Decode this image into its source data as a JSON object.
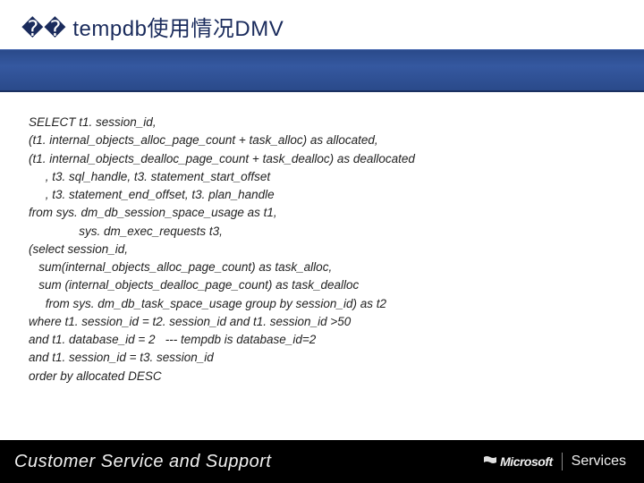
{
  "title": "�� tempdb使用情况DMV",
  "code_lines": [
    "SELECT t1. session_id,",
    "(t1. internal_objects_alloc_page_count + task_alloc) as allocated,",
    "(t1. internal_objects_dealloc_page_count + task_dealloc) as deallocated",
    "     , t3. sql_handle, t3. statement_start_offset",
    "     , t3. statement_end_offset, t3. plan_handle",
    "from sys. dm_db_session_space_usage as t1,",
    "               sys. dm_exec_requests t3,",
    "(select session_id,",
    "   sum(internal_objects_alloc_page_count) as task_alloc,",
    "   sum (internal_objects_dealloc_page_count) as task_dealloc",
    "     from sys. dm_db_task_space_usage group by session_id) as t2",
    "where t1. session_id = t2. session_id and t1. session_id >50",
    "and t1. database_id = 2   --- tempdb is database_id=2",
    "and t1. session_id = t3. session_id",
    "order by allocated DESC"
  ],
  "footer": {
    "left": "Customer Service and Support",
    "ms": "Microsoft",
    "services": "Services"
  }
}
